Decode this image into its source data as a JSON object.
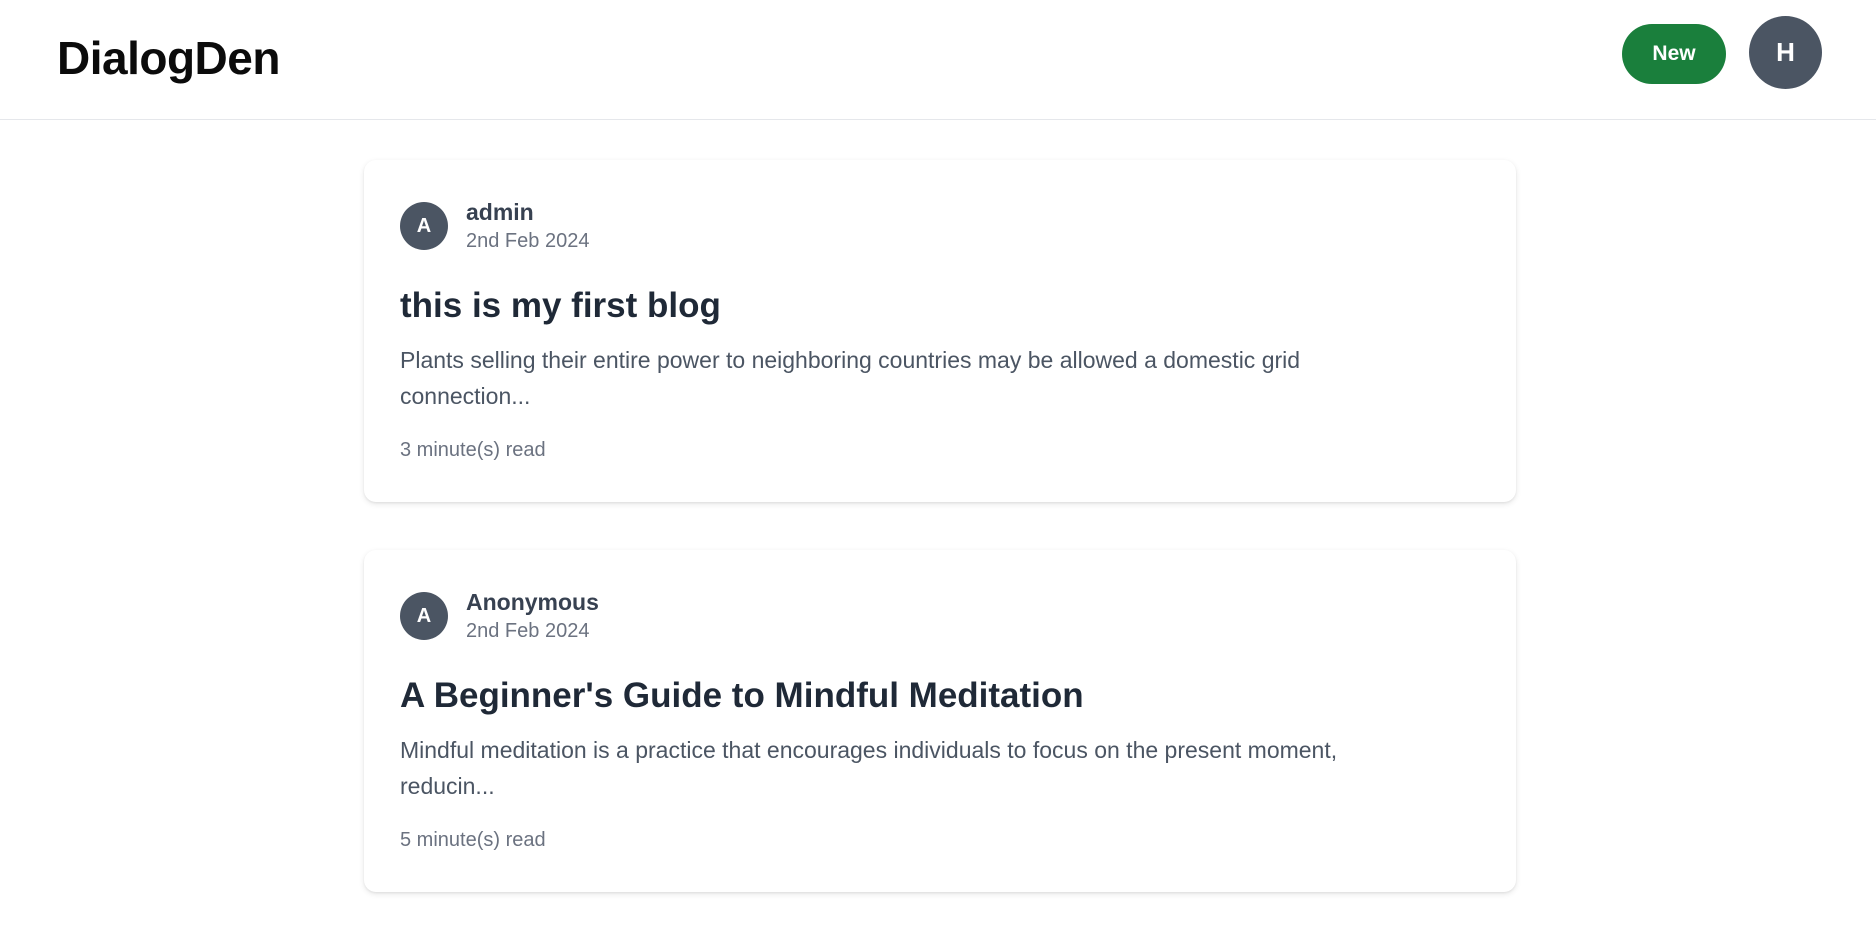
{
  "header": {
    "brand": "DialogDen",
    "new_button_label": "New",
    "user_initial": "H"
  },
  "posts": [
    {
      "author_initial": "A",
      "author": "admin",
      "date": "2nd Feb 2024",
      "title": "this is my first blog",
      "excerpt": "Plants selling their entire power to neighboring countries may be allowed a domestic grid connection...",
      "read_time": "3 minute(s) read"
    },
    {
      "author_initial": "A",
      "author": "Anonymous",
      "date": "2nd Feb 2024",
      "title": "A Beginner's Guide to Mindful Meditation",
      "excerpt": "Mindful meditation is a practice that encourages individuals to focus on the present moment, reducin...",
      "read_time": "5 minute(s) read"
    }
  ],
  "colors": {
    "new_button": "#1a7f3c",
    "avatar": "#4b5563"
  }
}
